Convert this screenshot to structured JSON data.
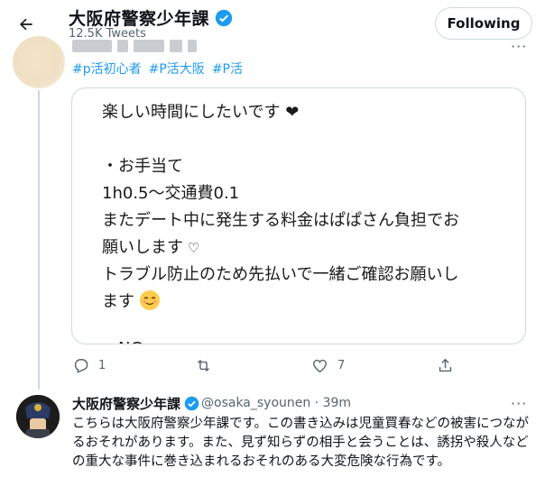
{
  "header": {
    "name": "大阪府警察少年課",
    "tweet_count": "12.5K Tweets",
    "follow_label": "Following"
  },
  "tweet": {
    "hashtags": [
      "#p活初心者",
      "#P活大阪",
      "#P活"
    ],
    "card_lines": [
      "楽しい時間にしたいです",
      "・お手当て",
      "1h0.5〜交通費0.1",
      "またデート中に発生する料金はぱぱさん負担でお",
      "願いします",
      "トラブル防止のため先払いで一緒ご確認お願いし",
      "ます",
      "・NG"
    ],
    "actions": {
      "reply_count": "1",
      "retweet_count": "",
      "like_count": "7"
    }
  },
  "reply": {
    "name": "大阪府警察少年課",
    "handle_time": "@osaka_syounen · 39m",
    "body": "こちらは大阪府警察少年課です。この書き込みは児童買春などの被害につながるおそれがあります。また、見ず知らずの相手と会うことは、誘拐や殺人などの重大な事件に巻き込まれるおそれのある大変危険な行為です。"
  },
  "colors": {
    "accent": "#1d9bf0",
    "muted": "#536471",
    "border": "#cfd9de"
  }
}
